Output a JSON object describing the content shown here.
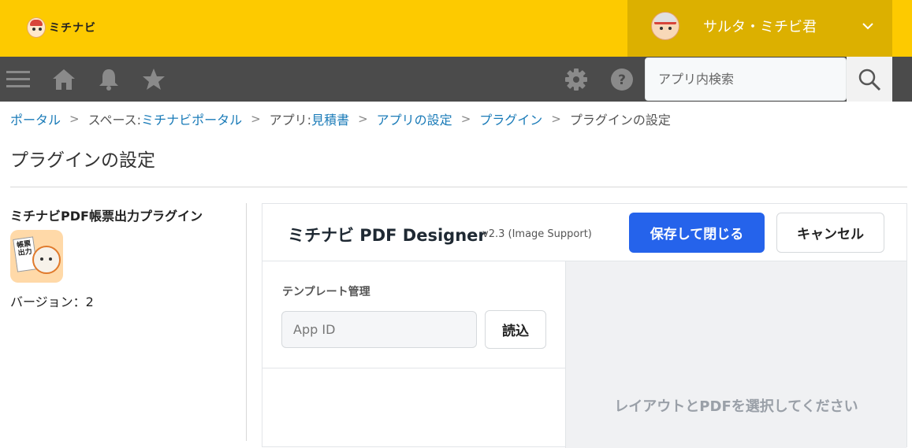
{
  "header": {
    "logo_text": "ミチナビ",
    "user_name": "サルタ・ミチビ君",
    "colors": {
      "header_bg": "#fdca00",
      "user_bg": "#dcb000",
      "toolbar_bg": "#4b4b4b"
    }
  },
  "toolbar": {
    "icons": [
      "menu-icon",
      "home-icon",
      "bell-icon",
      "star-icon",
      "gear-icon",
      "help-icon",
      "search-icon"
    ],
    "search_placeholder": "アプリ内検索"
  },
  "breadcrumb": {
    "portal": "ポータル",
    "space_prefix": "スペース: ",
    "space": "ミチナビポータル",
    "app_prefix": "アプリ: ",
    "app": "見積書",
    "app_settings": "アプリの設定",
    "plugins": "プラグイン",
    "current": "プラグインの設定",
    "separator": ">"
  },
  "page": {
    "title": "プラグインの設定"
  },
  "plugin": {
    "name": "ミチナビPDF帳票出力プラグイン",
    "icon_text": "帳票出力",
    "version_label": "バージョン：2"
  },
  "designer": {
    "title": "ミチナビ PDF Designer",
    "version": "v2.3 (Image Support)",
    "save_label": "保存して閉じる",
    "cancel_label": "キャンセル",
    "template_section_label": "テンプレート管理",
    "appid_placeholder": "App ID",
    "load_label": "読込",
    "preview_message": "レイアウトとPDFを選択してください",
    "accent_color": "#2563eb"
  }
}
